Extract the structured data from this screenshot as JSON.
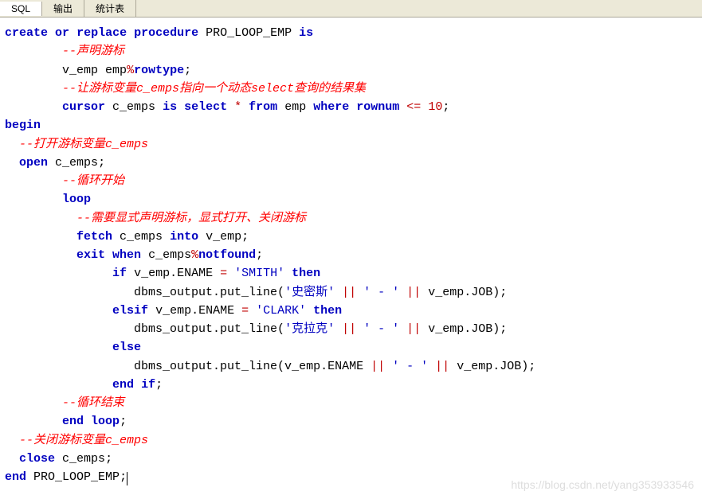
{
  "tabs": {
    "sql": "SQL",
    "output": "输出",
    "stats": "统计表"
  },
  "code": {
    "l01_create": "create",
    "l01_or": "or",
    "l01_replace": "replace",
    "l01_procedure": "procedure",
    "l01_name": "PRO_LOOP_EMP",
    "l01_is": "is",
    "l02_comment": "--声明游标",
    "l03_vemp": "v_emp",
    "l03_emp": "emp",
    "l03_pct": "%",
    "l03_rowtype": "rowtype",
    "l04_comment": "--让游标变量c_emps指向一个动态select查询的结果集",
    "l05_cursor": "cursor",
    "l05_cemps": "c_emps",
    "l05_is": "is",
    "l05_select": "select",
    "l05_star": "*",
    "l05_from": "from",
    "l05_emp": "emp",
    "l05_where": "where",
    "l05_rownum": "rownum",
    "l05_le": "<=",
    "l05_10": "10",
    "l06_begin": "begin",
    "l07_comment": "--打开游标变量c_emps",
    "l08_open": "open",
    "l08_cemps": "c_emps",
    "l09_comment": "--循环开始",
    "l10_loop": "loop",
    "l11_comment": "--需要显式声明游标，显式打开、关闭游标",
    "l12_fetch": "fetch",
    "l12_cemps": "c_emps",
    "l12_into": "into",
    "l12_vemp": "v_emp",
    "l13_exit": "exit",
    "l13_when": "when",
    "l13_cemps": "c_emps",
    "l13_pct": "%",
    "l13_notfound": "notfound",
    "l14_if": "if",
    "l14_vemp": "v_emp.ENAME",
    "l14_eq": "=",
    "l14_smith": "'SMITH'",
    "l14_then": "then",
    "l15_put": "dbms_output.put_line(",
    "l15_shimisi": "'史密斯'",
    "l15_bar": "||",
    "l15_dash": "' - '",
    "l15_job": "v_emp.JOB);",
    "l16_elsif": "elsif",
    "l16_vemp": "v_emp.ENAME",
    "l16_eq": "=",
    "l16_clark": "'CLARK'",
    "l16_then": "then",
    "l17_put": "dbms_output.put_line(",
    "l17_kelake": "'克拉克'",
    "l17_bar": "||",
    "l17_dash": "' - '",
    "l17_job": "v_emp.JOB);",
    "l18_else": "else",
    "l19_put": "dbms_output.put_line(v_emp.ENAME",
    "l19_bar": "||",
    "l19_dash": "' - '",
    "l19_job": "v_emp.JOB);",
    "l20_endif": "end",
    "l20_if": "if",
    "l21_comment": "--循环结束",
    "l22_end": "end",
    "l22_loop": "loop",
    "l23_comment": "--关闭游标变量c_emps",
    "l24_close": "close",
    "l24_cemps": "c_emps",
    "l25_end": "end",
    "l25_name": "PRO_LOOP_EMP"
  },
  "watermark": "https://blog.csdn.net/yang353933546"
}
